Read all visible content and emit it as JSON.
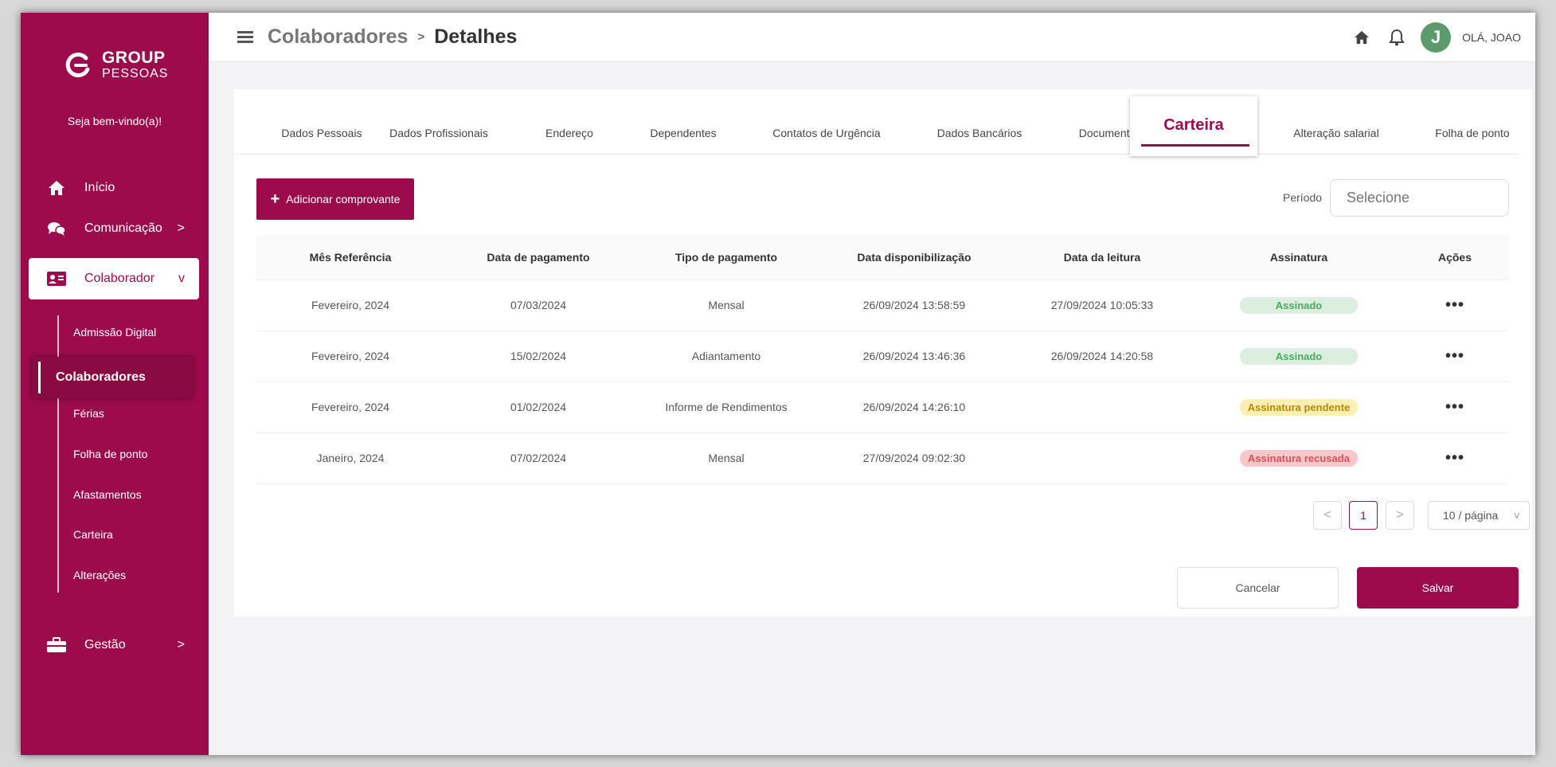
{
  "brand": {
    "line1": "GROUP",
    "line2": "PESSOAS",
    "color": "#9c0b4b"
  },
  "sidebar": {
    "welcome": "Seja bem-vindo(a)!",
    "items": [
      {
        "label": "Início",
        "icon": "home-icon"
      },
      {
        "label": "Comunicação",
        "icon": "chat-icon",
        "chevron": ">"
      },
      {
        "label": "Colaborador",
        "icon": "id-card-icon",
        "chevron": "v"
      },
      {
        "label": "Gestão",
        "icon": "briefcase-icon",
        "chevron": ">"
      }
    ],
    "sub_items": [
      "Admissão Digital",
      "Colaboradores",
      "Férias",
      "Folha de ponto",
      "Afastamentos",
      "Carteira",
      "Alterações"
    ]
  },
  "header": {
    "breadcrumb_parent": "Colaboradores",
    "breadcrumb_sep": ">",
    "breadcrumb_current": "Detalhes",
    "avatar_letter": "J",
    "greeting": "OLÁ, JOAO"
  },
  "tabs": [
    "Dados Pessoais",
    "Dados Profissionais",
    "Endereço",
    "Dependentes",
    "Contatos de Urgência",
    "Dados Bancários",
    "Documentos",
    "Carteira",
    "Alteração salarial",
    "Folha de ponto"
  ],
  "active_tab": "Carteira",
  "toolbar": {
    "add_label": "Adicionar comprovante",
    "period_label": "Período",
    "period_placeholder": "Selecione"
  },
  "table": {
    "columns": [
      "Mês Referência",
      "Data de pagamento",
      "Tipo de pagamento",
      "Data disponibilização",
      "Data da leitura",
      "Assinatura",
      "Ações"
    ],
    "rows": [
      {
        "mes": "Fevereiro, 2024",
        "pagamento": "07/03/2024",
        "tipo": "Mensal",
        "disponibilizacao": "26/09/2024 13:58:59",
        "leitura": "27/09/2024 10:05:33",
        "assinatura": "Assinado",
        "status": "green",
        "acoes": "•••"
      },
      {
        "mes": "Fevereiro, 2024",
        "pagamento": "15/02/2024",
        "tipo": "Adiantamento",
        "disponibilizacao": "26/09/2024 13:46:36",
        "leitura": "26/09/2024 14:20:58",
        "assinatura": "Assinado",
        "status": "green",
        "acoes": "•••"
      },
      {
        "mes": "Fevereiro, 2024",
        "pagamento": "01/02/2024",
        "tipo": "Informe de Rendimentos",
        "disponibilizacao": "26/09/2024 14:26:10",
        "leitura": "",
        "assinatura": "Assinatura pendente",
        "status": "yellow",
        "acoes": "•••"
      },
      {
        "mes": "Janeiro, 2024",
        "pagamento": "07/02/2024",
        "tipo": "Mensal",
        "disponibilizacao": "27/09/2024 09:02:30",
        "leitura": "",
        "assinatura": "Assinatura recusada",
        "status": "red",
        "acoes": "•••"
      }
    ]
  },
  "pagination": {
    "prev": "<",
    "current": "1",
    "next": ">",
    "page_size": "10 / página",
    "dropdown": "v"
  },
  "actions": {
    "cancel": "Cancelar",
    "save": "Salvar"
  },
  "colors": {
    "primary": "#9c0b4b",
    "success": "#4aaa5c",
    "warning": "#b98a00",
    "danger": "#d7505c"
  }
}
